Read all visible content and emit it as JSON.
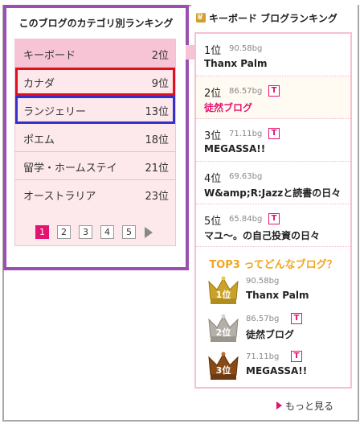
{
  "category_panel": {
    "title": "このブログのカテゴリ別ランキング",
    "items": [
      {
        "name": "キーボード",
        "rank": "2位"
      },
      {
        "name": "カナダ",
        "rank": "9位"
      },
      {
        "name": "ランジェリー",
        "rank": "13位"
      },
      {
        "name": "ポエム",
        "rank": "18位"
      },
      {
        "name": "留学・ホームステイ",
        "rank": "21位"
      },
      {
        "name": "オーストラリア",
        "rank": "23位"
      }
    ],
    "pages": [
      "1",
      "2",
      "3",
      "4",
      "5"
    ],
    "current_page": "1"
  },
  "blog_ranking": {
    "title": "キーボード ブログランキング",
    "entries": [
      {
        "rank": "1位",
        "score": "90.58bg",
        "name": "Thanx Palm"
      },
      {
        "rank": "2位",
        "score": "86.57bg",
        "name": "徒然ブログ",
        "badge": "T"
      },
      {
        "rank": "3位",
        "score": "71.11bg",
        "name": "MEGASSA!!",
        "badge": "T"
      },
      {
        "rank": "4位",
        "score": "69.63bg",
        "name": "W&amp;R:Jazzと読書の日々"
      },
      {
        "rank": "5位",
        "score": "65.84bg",
        "name": "マユ〜。の自己投資の日々",
        "badge": "T"
      }
    ],
    "top3_title": "TOP3 ってどんなブログ？",
    "top3": [
      {
        "crown_label": "1位",
        "score": "90.58bg",
        "name": "Thanx Palm"
      },
      {
        "crown_label": "2位",
        "score": "86.57bg",
        "name": "徒然ブログ",
        "badge": "T"
      },
      {
        "crown_label": "3位",
        "score": "71.11bg",
        "name": "MEGASSA!!",
        "badge": "T"
      }
    ],
    "more_label": "もっと見る"
  },
  "colors": {
    "accent_pink": "#e4136f",
    "panel_pink": "#fde8ec",
    "highlight_purple": "#9b4fb0",
    "highlight_red": "#e0101c",
    "highlight_blue": "#3333cc",
    "top3_orange": "#f3a51d",
    "gold": "#c9a227",
    "silver": "#b4b0a8",
    "bronze": "#8a4a16"
  }
}
